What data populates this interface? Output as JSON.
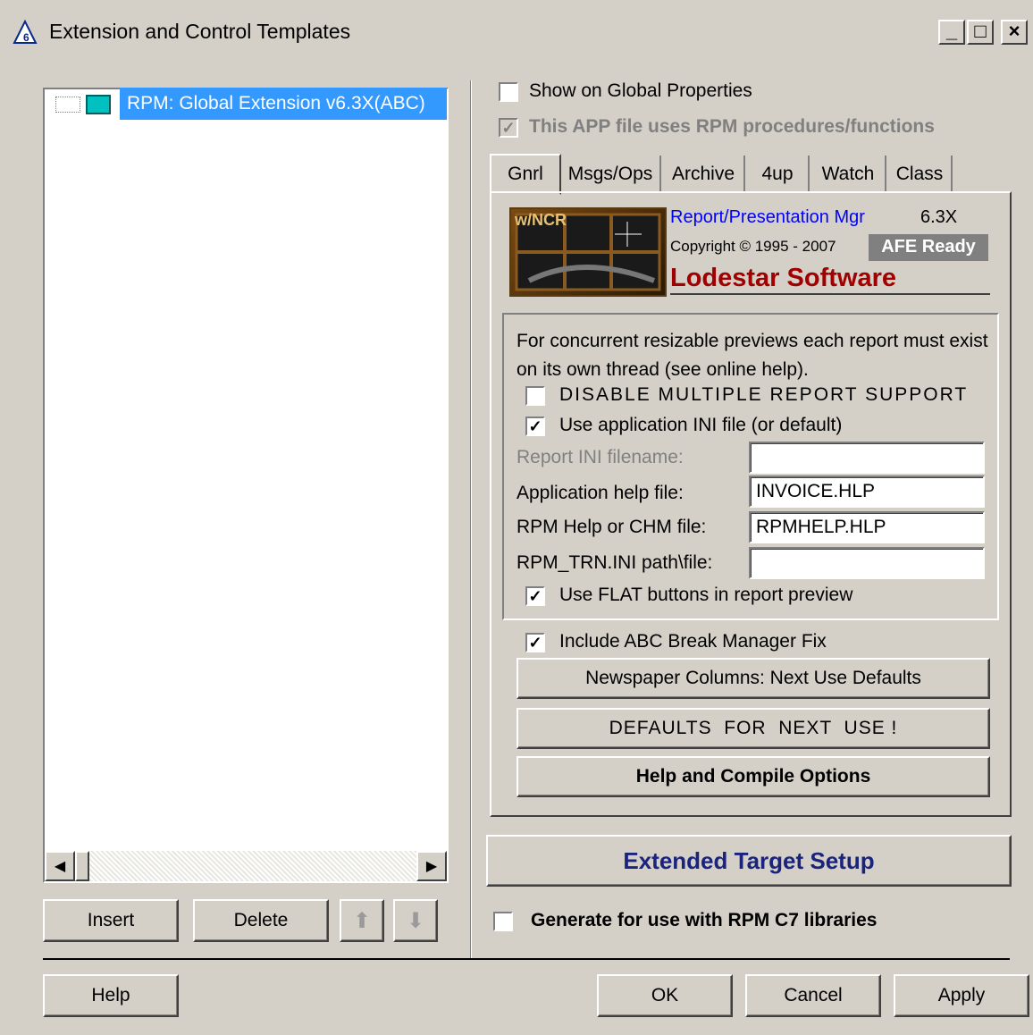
{
  "window": {
    "title": "Extension and Control Templates",
    "minimize_glyph": "_",
    "maximize_glyph": "□",
    "close_glyph": "×"
  },
  "tree": {
    "item_label": "RPM: Global Extension v6.3X(ABC)",
    "scroll_left": "◀",
    "scroll_right": "▶"
  },
  "list_buttons": {
    "insert": "Insert",
    "delete": "Delete",
    "up": "⬆",
    "down": "⬇"
  },
  "options": {
    "show_global": "Show on Global Properties",
    "uses_rpm": "This APP file uses RPM procedures/functions"
  },
  "tabs": [
    "Gnrl",
    "Msgs/Ops",
    "Archive",
    "4up",
    "Watch",
    "Class"
  ],
  "logo": {
    "badge_text": "w/NCR",
    "product": "Report/Presentation Mgr",
    "version": "6.3X",
    "copyright": "Copyright © 1995 - 2007",
    "afe": "AFE Ready",
    "company": "Lodestar Software"
  },
  "group": {
    "note": "For concurrent resizable previews each report must exist on its own thread (see online help).",
    "disable_multi": "DISABLE MULTIPLE REPORT SUPPORT",
    "use_ini": "Use application INI file (or default)",
    "report_ini_label": "Report INI filename:",
    "report_ini_value": "",
    "app_help_label": "Application help file:",
    "app_help_value": "INVOICE.HLP",
    "rpm_help_label": "RPM Help or CHM file:",
    "rpm_help_value": "RPMHELP.HLP",
    "trn_label": "RPM_TRN.INI path\\file:",
    "trn_value": "",
    "flat_buttons": "Use FLAT buttons in report preview"
  },
  "break_fix": "Include ABC Break Manager Fix",
  "buttons": {
    "newspaper": "Newspaper Columns: Next Use Defaults",
    "defaults": "DEFAULTS  FOR  NEXT  USE !",
    "help_compile": "Help and Compile Options",
    "extended_target": "Extended Target Setup"
  },
  "c7": "Generate for use with RPM C7 libraries",
  "footer": {
    "help": "Help",
    "ok": "OK",
    "cancel": "Cancel",
    "apply": "Apply"
  },
  "colors": {
    "face": "#d4d0c8",
    "selection": "#3399ff",
    "link_blue": "#0000ff",
    "company_red": "#a00000",
    "navy": "#1a237e"
  }
}
